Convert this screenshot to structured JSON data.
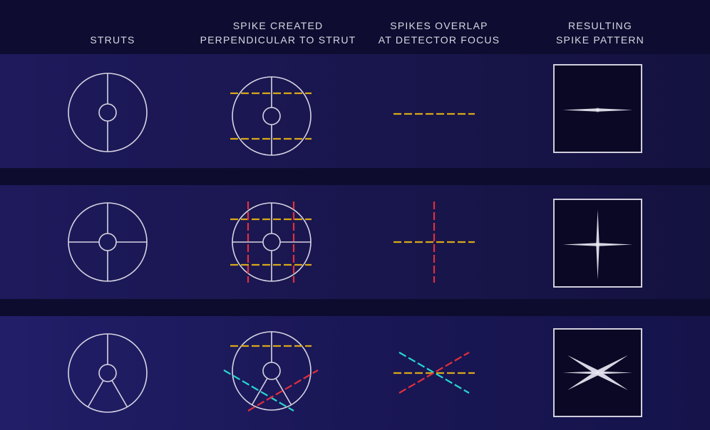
{
  "columns": [
    {
      "id": "struts",
      "lines": [
        "STRUTS"
      ]
    },
    {
      "id": "spike-created",
      "lines": [
        "SPIKE CREATED",
        "PERPENDICULAR TO STRUT"
      ]
    },
    {
      "id": "spikes-overlap",
      "lines": [
        "SPIKES OVERLAP",
        "AT DETECTOR FOCUS"
      ]
    },
    {
      "id": "resulting-pattern",
      "lines": [
        "RESULTING",
        "SPIKE PATTERN"
      ]
    }
  ],
  "colors": {
    "strut_line": "#d6d4e2",
    "spike_yellow": "#d9a818",
    "spike_red": "#e0303c",
    "spike_cyan": "#27d6cf",
    "detector_bg": "#0a0824",
    "detector_border": "#d0cedc"
  },
  "rows": [
    {
      "name": "one-strut-pair",
      "strut_angles_deg": [
        90,
        270
      ],
      "spike_colors": [
        "yellow"
      ],
      "spike_angles_deg": [
        0
      ],
      "result_spike_count": 2
    },
    {
      "name": "two-strut-pairs",
      "strut_angles_deg": [
        0,
        90,
        180,
        270
      ],
      "spike_colors": [
        "yellow",
        "red"
      ],
      "spike_angles_deg": [
        0,
        90
      ],
      "result_spike_count": 4
    },
    {
      "name": "three-struts",
      "strut_angles_deg": [
        90,
        240,
        300
      ],
      "spike_colors": [
        "yellow",
        "red",
        "cyan"
      ],
      "spike_angles_deg": [
        0,
        30,
        -30
      ],
      "result_spike_count": 6
    }
  ]
}
